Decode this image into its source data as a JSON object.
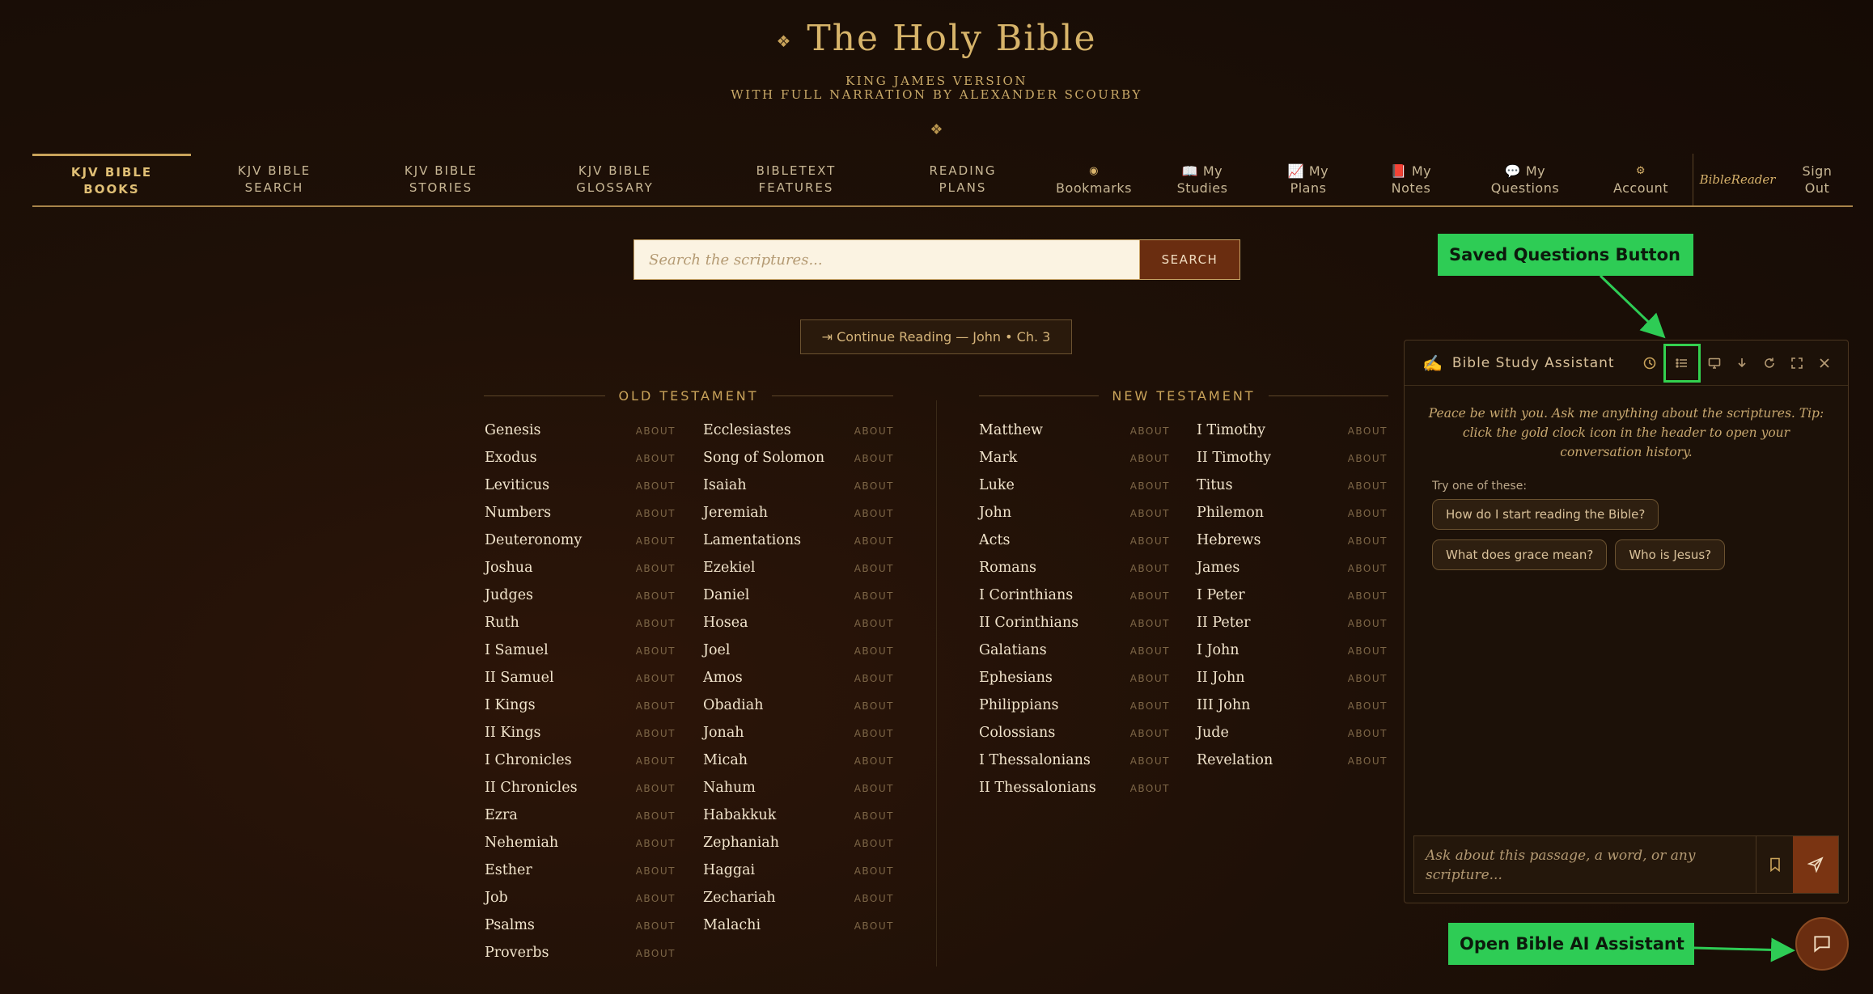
{
  "header": {
    "title_ornament": "❖",
    "title": "The Holy Bible",
    "subtitle_line1": "KING JAMES VERSION",
    "subtitle_line2": "WITH FULL NARRATION BY ALEXANDER SCOURBY",
    "ornament": "❖"
  },
  "nav": [
    {
      "line1": "KJV BIBLE",
      "line2": "BOOKS",
      "active": true
    },
    {
      "line1": "KJV BIBLE",
      "line2": "SEARCH"
    },
    {
      "line1": "KJV BIBLE",
      "line2": "STORIES"
    },
    {
      "line1": "KJV BIBLE",
      "line2": "GLOSSARY"
    },
    {
      "line1": "BIBLETEXT",
      "line2": "FEATURES"
    },
    {
      "line1": "READING",
      "line2": "PLANS"
    },
    {
      "line1": "◉",
      "line2": "Bookmarks"
    },
    {
      "line1": "📖 My",
      "line2": "Studies"
    },
    {
      "line1": "📈 My",
      "line2": "Plans"
    },
    {
      "line1": "📕 My",
      "line2": "Notes"
    },
    {
      "line1": "💬 My",
      "line2": "Questions"
    },
    {
      "line1": "⚙",
      "line2": "Account"
    },
    {
      "line1": "BibleReader",
      "line2": ""
    },
    {
      "line1": "Sign",
      "line2": "Out"
    }
  ],
  "search": {
    "placeholder": "Search the scriptures...",
    "button": "SEARCH"
  },
  "continue_reading": "⇥ Continue Reading — John • Ch. 3",
  "old_testament": {
    "heading": "OLD TESTAMENT",
    "col1": [
      "Genesis",
      "Exodus",
      "Leviticus",
      "Numbers",
      "Deuteronomy",
      "Joshua",
      "Judges",
      "Ruth",
      "I Samuel",
      "II Samuel",
      "I Kings",
      "II Kings",
      "I Chronicles",
      "II Chronicles",
      "Ezra",
      "Nehemiah",
      "Esther",
      "Job",
      "Psalms",
      "Proverbs"
    ],
    "col2": [
      "Ecclesiastes",
      "Song of Solomon",
      "Isaiah",
      "Jeremiah",
      "Lamentations",
      "Ezekiel",
      "Daniel",
      "Hosea",
      "Joel",
      "Amos",
      "Obadiah",
      "Jonah",
      "Micah",
      "Nahum",
      "Habakkuk",
      "Zephaniah",
      "Haggai",
      "Zechariah",
      "Malachi"
    ]
  },
  "new_testament": {
    "heading": "NEW TESTAMENT",
    "col1": [
      "Matthew",
      "Mark",
      "Luke",
      "John",
      "Acts",
      "Romans",
      "I Corinthians",
      "II Corinthians",
      "Galatians",
      "Ephesians",
      "Philippians",
      "Colossians",
      "I Thessalonians",
      "II Thessalonians"
    ],
    "col2": [
      "I Timothy",
      "II Timothy",
      "Titus",
      "Philemon",
      "Hebrews",
      "James",
      "I Peter",
      "II Peter",
      "I John",
      "II John",
      "III John",
      "Jude",
      "Revelation"
    ]
  },
  "about_label": "ABOUT",
  "assistant": {
    "icon": "✍",
    "title": "Bible Study Assistant",
    "greeting": "Peace be with you. Ask me anything about the scriptures. Tip: click the gold clock icon in the header to open your conversation history.",
    "try_label": "Try one of these:",
    "suggestions": [
      "How do I start reading the Bible?",
      "What does grace mean?",
      "Who is Jesus?"
    ],
    "input_placeholder": "Ask about this passage, a word, or any scripture..."
  },
  "annotations": {
    "saved_questions": "Saved Questions Button",
    "open_assistant": "Open Bible AI Assistant",
    "color": "#2ecc55"
  }
}
